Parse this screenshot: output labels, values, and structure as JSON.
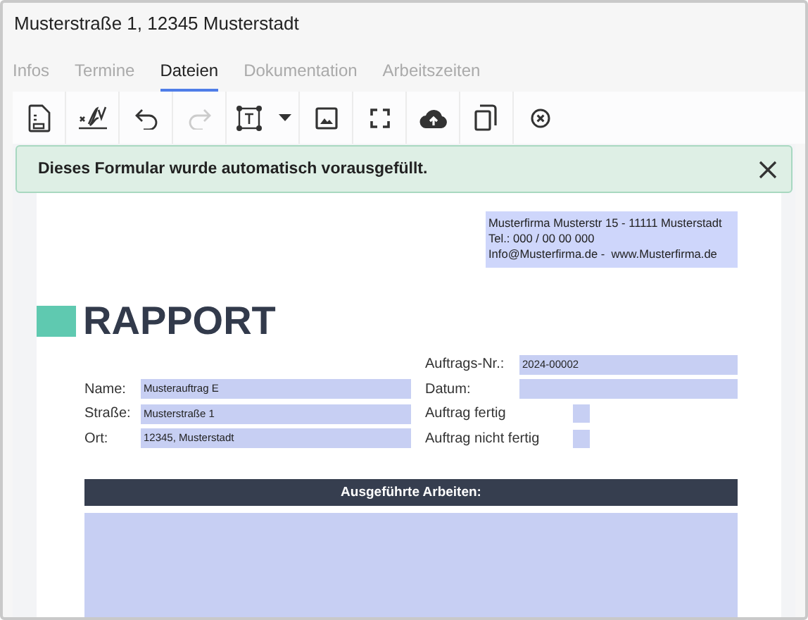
{
  "window": {
    "title": "Musterstraße 1, 12345 Musterstadt"
  },
  "tabs": [
    {
      "label": "Infos",
      "selected": false
    },
    {
      "label": "Termine",
      "selected": false
    },
    {
      "label": "Dateien",
      "selected": true
    },
    {
      "label": "Dokumentation",
      "selected": false
    },
    {
      "label": "Arbeitszeiten",
      "selected": false
    }
  ],
  "toolbar": [
    {
      "disabled": false
    },
    {
      "disabled": false
    },
    {
      "disabled": false
    },
    {
      "disabled": true
    },
    {
      "disabled": false
    },
    {
      "disabled": false
    },
    {
      "disabled": false
    },
    {
      "disabled": false
    },
    {
      "disabled": false
    },
    {
      "disabled": false
    }
  ],
  "notice": {
    "text": "Dieses Formular wurde automatisch vorausgefüllt."
  },
  "document": {
    "address": [
      "Musterfirma Musterstr 15 - 11111 Musterstadt",
      "Tel.: 000 / 00 00 000",
      "Info@Musterfirma.de -  www.Musterfirma.de"
    ],
    "heading": "RAPPORT",
    "left_fields": [
      {
        "label": "Name:",
        "value": "Musterauftrag E"
      },
      {
        "label": "Straße:",
        "value": "Musterstraße 1"
      },
      {
        "label": "Ort:",
        "value": "12345, Musterstadt"
      }
    ],
    "right_fields": [
      {
        "label": "Auftrags-Nr.:",
        "kind": "text",
        "value": "2024-00002"
      },
      {
        "label": "Datum:",
        "kind": "text"
      },
      {
        "label": "Auftrag fertig",
        "kind": "checkbox",
        "checked": false
      },
      {
        "label": "Auftrag nicht fertig",
        "kind": "checkbox",
        "checked": false
      }
    ],
    "section_title": "Ausgeführte Arbeiten:"
  }
}
